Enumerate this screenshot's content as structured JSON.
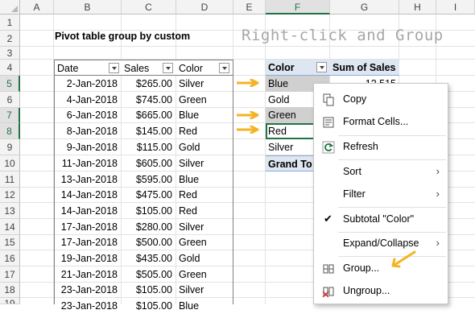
{
  "columns": [
    "A",
    "B",
    "C",
    "D",
    "E",
    "F",
    "G",
    "H",
    "I"
  ],
  "rows": [
    "1",
    "2",
    "3",
    "4",
    "5",
    "6",
    "7",
    "8",
    "9",
    "10",
    "11",
    "12",
    "13",
    "14",
    "15",
    "16",
    "17",
    "18",
    "19"
  ],
  "title": "Pivot table group by custom",
  "annotation": "Right-click and Group",
  "source_table": {
    "headers": [
      "Date",
      "Sales",
      "Color"
    ],
    "rows": [
      [
        "2-Jan-2018",
        "$265.00",
        "Silver"
      ],
      [
        "4-Jan-2018",
        "$745.00",
        "Green"
      ],
      [
        "6-Jan-2018",
        "$665.00",
        "Blue"
      ],
      [
        "8-Jan-2018",
        "$145.00",
        "Red"
      ],
      [
        "9-Jan-2018",
        "$115.00",
        "Gold"
      ],
      [
        "11-Jan-2018",
        "$605.00",
        "Silver"
      ],
      [
        "13-Jan-2018",
        "$595.00",
        "Blue"
      ],
      [
        "14-Jan-2018",
        "$475.00",
        "Red"
      ],
      [
        "14-Jan-2018",
        "$105.00",
        "Red"
      ],
      [
        "17-Jan-2018",
        "$280.00",
        "Silver"
      ],
      [
        "17-Jan-2018",
        "$500.00",
        "Green"
      ],
      [
        "19-Jan-2018",
        "$435.00",
        "Gold"
      ],
      [
        "21-Jan-2018",
        "$505.00",
        "Green"
      ],
      [
        "23-Jan-2018",
        "$105.00",
        "Silver"
      ],
      [
        "23-Jan-2018",
        "$105.00",
        "Blue"
      ]
    ]
  },
  "pivot": {
    "header_color": "Color",
    "header_sum": "Sum of Sales",
    "items": [
      "Blue",
      "Gold",
      "Green",
      "Red",
      "Silver"
    ],
    "first_value": "12,515",
    "grand_total": "Grand To"
  },
  "context_menu": {
    "items": [
      {
        "label": "Copy",
        "icon": "copy-icon"
      },
      {
        "label": "Format Cells...",
        "icon": "format-cells-icon"
      },
      {
        "label": "Refresh",
        "icon": "refresh-icon"
      },
      {
        "label": "Sort",
        "submenu": true
      },
      {
        "label": "Filter",
        "submenu": true
      },
      {
        "label": "Subtotal \"Color\"",
        "checked": true
      },
      {
        "label": "Expand/Collapse",
        "submenu": true
      },
      {
        "label": "Group...",
        "icon": "group-icon"
      },
      {
        "label": "Ungroup...",
        "icon": "ungroup-icon"
      }
    ]
  },
  "colors": {
    "accent": "#217346",
    "arrow": "#f4b323",
    "pivot_header": "#dde6f1"
  }
}
